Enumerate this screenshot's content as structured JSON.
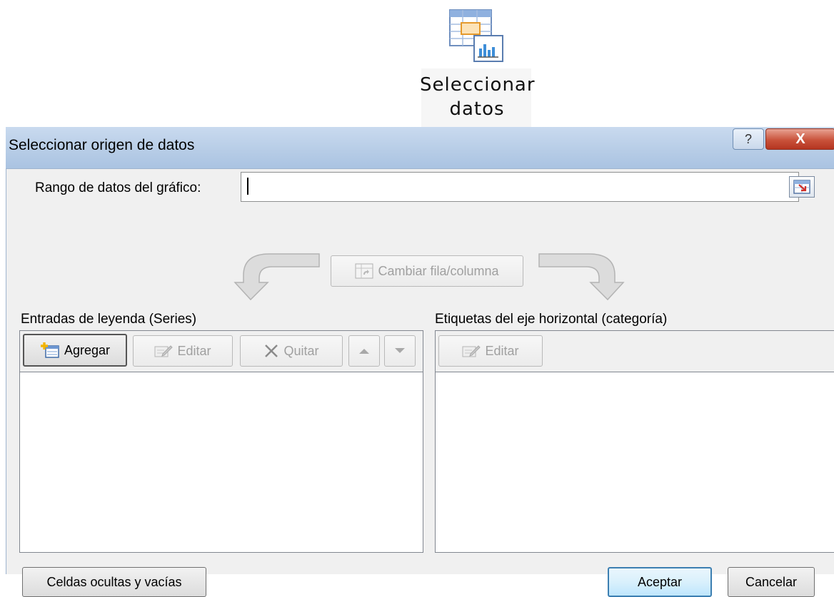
{
  "ribbon": {
    "button_label_line1": "Seleccionar",
    "button_label_line2": "datos",
    "icon": "select-data-icon"
  },
  "dialog": {
    "title": "Seleccionar origen de datos",
    "help_label": "?",
    "close_label": "X",
    "chart_range": {
      "label": "Rango de datos del gráfico:",
      "value": ""
    },
    "switch_button": "Cambiar fila/columna",
    "series": {
      "heading": "Entradas de leyenda (Series)",
      "add": "Agregar",
      "edit": "Editar",
      "remove": "Quitar",
      "items": []
    },
    "categories": {
      "heading": "Etiquetas del eje horizontal (categoría)",
      "edit": "Editar",
      "items": []
    },
    "hidden_cells_button": "Celdas ocultas y vacías",
    "ok_button": "Aceptar",
    "cancel_button": "Cancelar"
  },
  "colors": {
    "titlebar": "#b6cce6",
    "close": "#c9523b",
    "dialog_bg": "#f0f0f0"
  }
}
